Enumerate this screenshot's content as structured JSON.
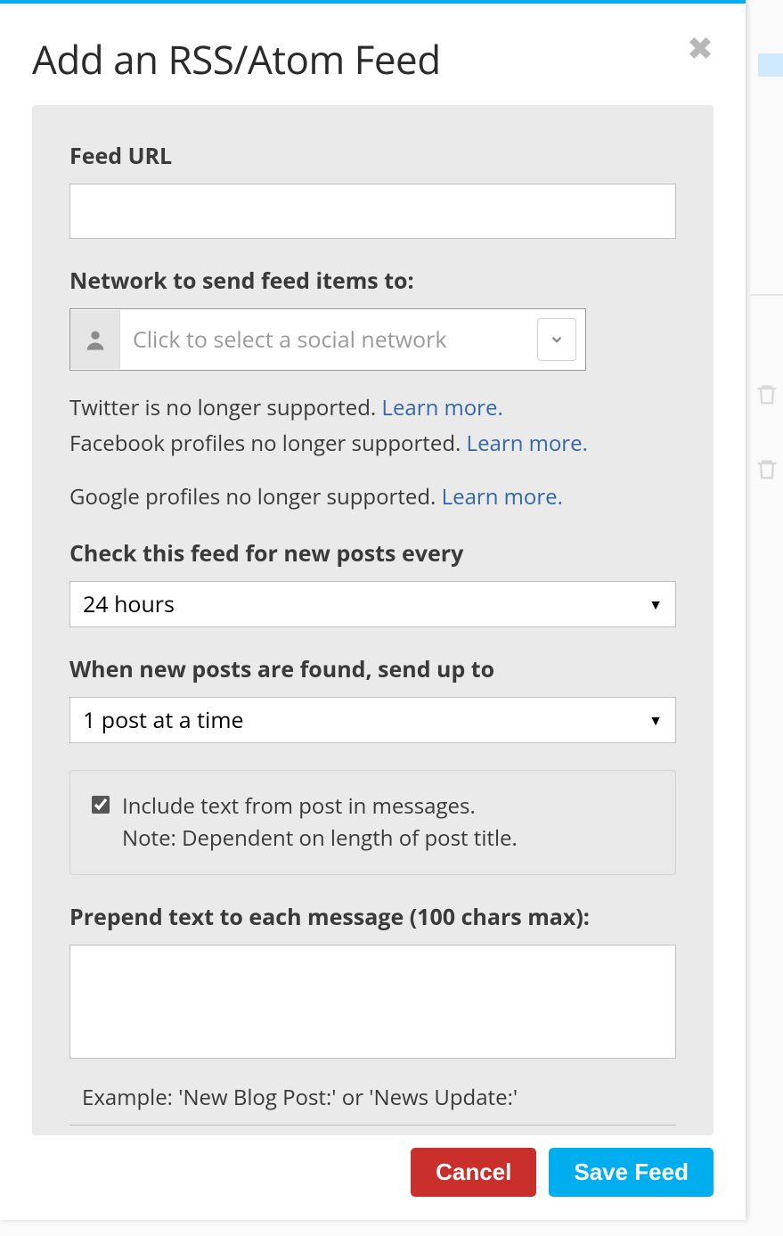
{
  "modal": {
    "title": "Add an RSS/Atom Feed"
  },
  "form": {
    "feed_url_label": "Feed URL",
    "feed_url_value": "",
    "network_label": "Network to send feed items to:",
    "network_placeholder": "Click to select a social network",
    "twitter_notice": "Twitter is no longer supported. ",
    "twitter_link": "Learn more.",
    "facebook_notice": "Facebook profiles no longer supported. ",
    "facebook_link": "Learn more.",
    "google_notice": "Google profiles no longer supported. ",
    "google_link": "Learn more.",
    "interval_label": "Check this feed for new posts every",
    "interval_value": "24 hours",
    "send_up_label": "When new posts are found, send up to",
    "send_up_value": "1 post at a time",
    "include_text_label": "Include text from post in messages.",
    "include_text_note": "Note: Dependent on length of post title.",
    "include_text_checked": true,
    "prepend_label": "Prepend text to each message (100 chars max):",
    "prepend_value": "",
    "example": "Example: 'New Blog Post:' or 'News Update:'"
  },
  "footer": {
    "cancel": "Cancel",
    "save": "Save Feed"
  }
}
